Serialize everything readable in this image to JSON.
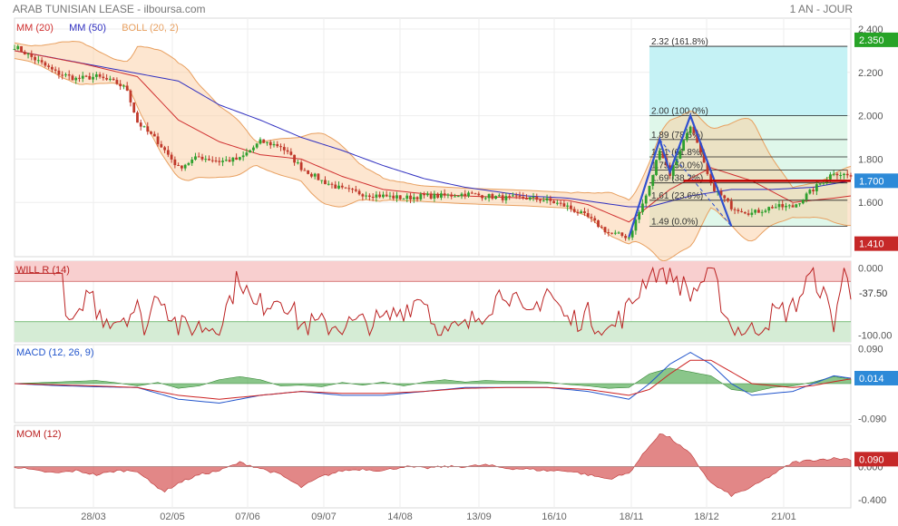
{
  "header": {
    "title": "ARAB TUNISIAN LEASE - ilboursa.com",
    "period": "1 AN - JOUR"
  },
  "colors": {
    "up": "#2ea02e",
    "down": "#c0392b",
    "ma20": "#d03030",
    "ma50": "#3030c0",
    "boll": "#e8a060",
    "fib_fill": "#bdeef2",
    "harmonic": "#3050d0",
    "last_price": "#2d8ad8",
    "axis_green": "#27a327",
    "axis_red": "#c62828"
  },
  "x_ticks": [
    "28/03",
    "02/05",
    "07/06",
    "09/07",
    "14/08",
    "13/09",
    "16/10",
    "18/11",
    "18/12",
    "21/01"
  ],
  "chart_data": [
    {
      "type": "line",
      "panel": "price",
      "legend": [
        "MM (20)",
        "MM (50)",
        "BOLL (20, 2)"
      ],
      "ylim": [
        1.35,
        2.45
      ],
      "yticks": [
        "2.400",
        "2.200",
        "2.000",
        "1.800",
        "1.600"
      ],
      "markers": [
        {
          "label": "2.350",
          "value": 2.35,
          "color": "green"
        },
        {
          "label": "1.700",
          "value": 1.7,
          "color": "blue"
        },
        {
          "label": "1.410",
          "value": 1.41,
          "color": "red"
        }
      ],
      "fib_levels": [
        {
          "label": "2.32  (161.8%)",
          "value": 2.32
        },
        {
          "label": "2.00  (100.0%)",
          "value": 2.0
        },
        {
          "label": "1.89  (78.6%)",
          "value": 1.89
        },
        {
          "label": "1.81  (61.8%)",
          "value": 1.81
        },
        {
          "label": "1.75  (50.0%)",
          "value": 1.75
        },
        {
          "label": "1.69  (38.2%)",
          "value": 1.69
        },
        {
          "label": "1.61  (23.6%)",
          "value": 1.61
        },
        {
          "label": "1.49  (0.0%)",
          "value": 1.49
        }
      ],
      "close_anchors": [
        [
          0,
          2.32
        ],
        [
          6,
          2.26
        ],
        [
          12,
          2.2
        ],
        [
          18,
          2.17
        ],
        [
          24,
          2.18
        ],
        [
          30,
          2.15
        ],
        [
          33,
          2.12
        ],
        [
          36,
          1.97
        ],
        [
          42,
          1.88
        ],
        [
          48,
          1.76
        ],
        [
          54,
          1.81
        ],
        [
          60,
          1.79
        ],
        [
          66,
          1.8
        ],
        [
          72,
          1.88
        ],
        [
          78,
          1.86
        ],
        [
          84,
          1.76
        ],
        [
          90,
          1.7
        ],
        [
          96,
          1.66
        ],
        [
          102,
          1.64
        ],
        [
          108,
          1.63
        ],
        [
          114,
          1.62
        ],
        [
          120,
          1.63
        ],
        [
          126,
          1.63
        ],
        [
          132,
          1.64
        ],
        [
          138,
          1.63
        ],
        [
          144,
          1.62
        ],
        [
          150,
          1.62
        ],
        [
          156,
          1.61
        ],
        [
          162,
          1.58
        ],
        [
          168,
          1.53
        ],
        [
          174,
          1.46
        ],
        [
          180,
          1.44
        ],
        [
          186,
          1.67
        ],
        [
          189,
          1.85
        ],
        [
          192,
          1.73
        ],
        [
          198,
          1.96
        ],
        [
          204,
          1.68
        ],
        [
          210,
          1.58
        ],
        [
          216,
          1.55
        ],
        [
          222,
          1.58
        ],
        [
          228,
          1.58
        ],
        [
          234,
          1.66
        ],
        [
          240,
          1.74
        ],
        [
          245,
          1.72
        ]
      ],
      "series": [
        {
          "name": "MM (20)",
          "anchors": [
            [
              0,
              2.3
            ],
            [
              20,
              2.24
            ],
            [
              36,
              2.18
            ],
            [
              48,
              1.98
            ],
            [
              60,
              1.88
            ],
            [
              72,
              1.82
            ],
            [
              84,
              1.8
            ],
            [
              96,
              1.72
            ],
            [
              108,
              1.66
            ],
            [
              120,
              1.64
            ],
            [
              132,
              1.63
            ],
            [
              150,
              1.62
            ],
            [
              162,
              1.61
            ],
            [
              168,
              1.59
            ],
            [
              180,
              1.51
            ],
            [
              192,
              1.66
            ],
            [
              204,
              1.76
            ],
            [
              216,
              1.7
            ],
            [
              228,
              1.6
            ],
            [
              240,
              1.62
            ],
            [
              245,
              1.63
            ]
          ]
        },
        {
          "name": "MM (50)",
          "anchors": [
            [
              0,
              2.3
            ],
            [
              24,
              2.23
            ],
            [
              48,
              2.16
            ],
            [
              60,
              2.05
            ],
            [
              72,
              1.98
            ],
            [
              84,
              1.9
            ],
            [
              96,
              1.84
            ],
            [
              108,
              1.77
            ],
            [
              120,
              1.71
            ],
            [
              132,
              1.67
            ],
            [
              150,
              1.63
            ],
            [
              162,
              1.62
            ],
            [
              180,
              1.58
            ],
            [
              186,
              1.58
            ],
            [
              198,
              1.63
            ],
            [
              210,
              1.66
            ],
            [
              222,
              1.66
            ],
            [
              234,
              1.67
            ],
            [
              245,
              1.7
            ]
          ]
        }
      ],
      "harmonic": [
        [
          180,
          1.44
        ],
        [
          189,
          1.89
        ],
        [
          192,
          1.74
        ],
        [
          198,
          2.0
        ],
        [
          210,
          1.49
        ],
        [
          216,
          1.61
        ],
        [
          228,
          1.69
        ],
        [
          240,
          1.69
        ]
      ]
    },
    {
      "type": "line",
      "panel": "will_r",
      "legend": "WILL R (14)",
      "ylim": [
        -110,
        10
      ],
      "yticks": [
        "0.000",
        "-100.00"
      ],
      "bands": {
        "upper": -20,
        "lower": -80
      },
      "marker": {
        "label": "-37.50",
        "value": -37.5
      },
      "anchors": [
        [
          0,
          -8
        ],
        [
          14,
          -8
        ],
        [
          16,
          -95
        ],
        [
          18,
          -70
        ],
        [
          20,
          -80
        ],
        [
          22,
          -20
        ],
        [
          24,
          -70
        ],
        [
          30,
          -75
        ],
        [
          36,
          -60
        ],
        [
          38,
          -100
        ],
        [
          42,
          -30
        ],
        [
          48,
          -90
        ],
        [
          60,
          -85
        ],
        [
          66,
          -10
        ],
        [
          70,
          -60
        ],
        [
          78,
          -40
        ],
        [
          84,
          -85
        ],
        [
          96,
          -85
        ],
        [
          108,
          -80
        ],
        [
          120,
          -40
        ],
        [
          124,
          -100
        ],
        [
          132,
          -90
        ],
        [
          138,
          -60
        ],
        [
          144,
          -30
        ],
        [
          150,
          -80
        ],
        [
          156,
          -30
        ],
        [
          162,
          -80
        ],
        [
          168,
          -70
        ],
        [
          174,
          -95
        ],
        [
          180,
          -60
        ],
        [
          186,
          -5
        ],
        [
          192,
          -5
        ],
        [
          198,
          -40
        ],
        [
          204,
          -5
        ],
        [
          210,
          -90
        ],
        [
          216,
          -95
        ],
        [
          222,
          -70
        ],
        [
          228,
          -60
        ],
        [
          234,
          -5
        ],
        [
          240,
          -80
        ],
        [
          243,
          -5
        ],
        [
          245,
          -37.5
        ]
      ]
    },
    {
      "type": "area",
      "panel": "macd",
      "legend": "MACD (12, 26, 9)",
      "ylim": [
        -0.1,
        0.1
      ],
      "yticks": [
        "0.090",
        "-0.090"
      ],
      "marker": {
        "label": "0.014",
        "value": 0.014
      },
      "macd": [
        [
          0,
          0
        ],
        [
          12,
          -0.005
        ],
        [
          24,
          -0.008
        ],
        [
          36,
          -0.01
        ],
        [
          48,
          -0.04
        ],
        [
          60,
          -0.05
        ],
        [
          72,
          -0.03
        ],
        [
          84,
          -0.02
        ],
        [
          96,
          -0.03
        ],
        [
          108,
          -0.03
        ],
        [
          120,
          -0.02
        ],
        [
          132,
          -0.01
        ],
        [
          144,
          -0.01
        ],
        [
          156,
          -0.01
        ],
        [
          168,
          -0.02
        ],
        [
          180,
          -0.04
        ],
        [
          186,
          0.0
        ],
        [
          192,
          0.05
        ],
        [
          198,
          0.08
        ],
        [
          204,
          0.05
        ],
        [
          210,
          0.0
        ],
        [
          216,
          -0.03
        ],
        [
          228,
          -0.02
        ],
        [
          234,
          0.0
        ],
        [
          240,
          0.02
        ],
        [
          245,
          0.014
        ]
      ],
      "signal": [
        [
          0,
          0
        ],
        [
          12,
          -0.003
        ],
        [
          24,
          -0.006
        ],
        [
          36,
          -0.01
        ],
        [
          48,
          -0.03
        ],
        [
          60,
          -0.04
        ],
        [
          72,
          -0.03
        ],
        [
          84,
          -0.02
        ],
        [
          96,
          -0.025
        ],
        [
          108,
          -0.025
        ],
        [
          120,
          -0.02
        ],
        [
          132,
          -0.012
        ],
        [
          144,
          -0.01
        ],
        [
          156,
          -0.01
        ],
        [
          168,
          -0.015
        ],
        [
          180,
          -0.03
        ],
        [
          186,
          -0.015
        ],
        [
          192,
          0.025
        ],
        [
          198,
          0.06
        ],
        [
          204,
          0.06
        ],
        [
          210,
          0.03
        ],
        [
          216,
          0.0
        ],
        [
          228,
          -0.01
        ],
        [
          234,
          -0.005
        ],
        [
          240,
          0.005
        ],
        [
          245,
          0.012
        ]
      ],
      "histogram": [
        [
          0,
          0
        ],
        [
          12,
          0.004
        ],
        [
          24,
          0.008
        ],
        [
          30,
          0.002
        ],
        [
          36,
          -0.006
        ],
        [
          42,
          0.003
        ],
        [
          48,
          -0.012
        ],
        [
          54,
          -0.006
        ],
        [
          60,
          0.01
        ],
        [
          66,
          0.018
        ],
        [
          72,
          0.01
        ],
        [
          78,
          -0.006
        ],
        [
          84,
          -0.004
        ],
        [
          90,
          -0.008
        ],
        [
          96,
          0.003
        ],
        [
          102,
          -0.004
        ],
        [
          108,
          0.004
        ],
        [
          114,
          -0.006
        ],
        [
          120,
          0.004
        ],
        [
          126,
          0.01
        ],
        [
          132,
          0.004
        ],
        [
          138,
          0.008
        ],
        [
          144,
          0.006
        ],
        [
          150,
          0.006
        ],
        [
          156,
          0.004
        ],
        [
          162,
          -0.002
        ],
        [
          168,
          -0.006
        ],
        [
          174,
          -0.012
        ],
        [
          180,
          -0.01
        ],
        [
          186,
          0.025
        ],
        [
          192,
          0.04
        ],
        [
          198,
          0.03
        ],
        [
          204,
          0.02
        ],
        [
          210,
          -0.015
        ],
        [
          216,
          -0.022
        ],
        [
          222,
          -0.01
        ],
        [
          228,
          -0.006
        ],
        [
          234,
          0.004
        ],
        [
          240,
          0.018
        ],
        [
          245,
          0.012
        ]
      ]
    },
    {
      "type": "area",
      "panel": "momentum",
      "legend": "MOM (12)",
      "ylim": [
        -0.5,
        0.5
      ],
      "yticks": [
        "0.000",
        "-0.400"
      ],
      "marker": {
        "label": "0.090",
        "value": 0.09
      },
      "anchors": [
        [
          0,
          0
        ],
        [
          6,
          -0.05
        ],
        [
          12,
          -0.08
        ],
        [
          18,
          -0.05
        ],
        [
          24,
          -0.1
        ],
        [
          30,
          -0.05
        ],
        [
          36,
          -0.05
        ],
        [
          40,
          -0.2
        ],
        [
          44,
          -0.3
        ],
        [
          48,
          -0.2
        ],
        [
          54,
          -0.1
        ],
        [
          60,
          -0.05
        ],
        [
          66,
          0.05
        ],
        [
          72,
          -0.02
        ],
        [
          78,
          -0.1
        ],
        [
          84,
          -0.25
        ],
        [
          90,
          -0.12
        ],
        [
          96,
          -0.05
        ],
        [
          102,
          -0.03
        ],
        [
          108,
          -0.05
        ],
        [
          114,
          0.0
        ],
        [
          120,
          -0.02
        ],
        [
          126,
          0.0
        ],
        [
          132,
          0.0
        ],
        [
          138,
          0.02
        ],
        [
          144,
          -0.02
        ],
        [
          150,
          -0.03
        ],
        [
          156,
          -0.05
        ],
        [
          162,
          -0.05
        ],
        [
          168,
          -0.1
        ],
        [
          174,
          -0.15
        ],
        [
          180,
          -0.08
        ],
        [
          186,
          0.25
        ],
        [
          189,
          0.4
        ],
        [
          192,
          0.35
        ],
        [
          198,
          0.15
        ],
        [
          204,
          -0.2
        ],
        [
          210,
          -0.35
        ],
        [
          216,
          -0.25
        ],
        [
          222,
          -0.1
        ],
        [
          228,
          0.05
        ],
        [
          234,
          0.08
        ],
        [
          240,
          0.1
        ],
        [
          245,
          0.09
        ]
      ]
    }
  ]
}
